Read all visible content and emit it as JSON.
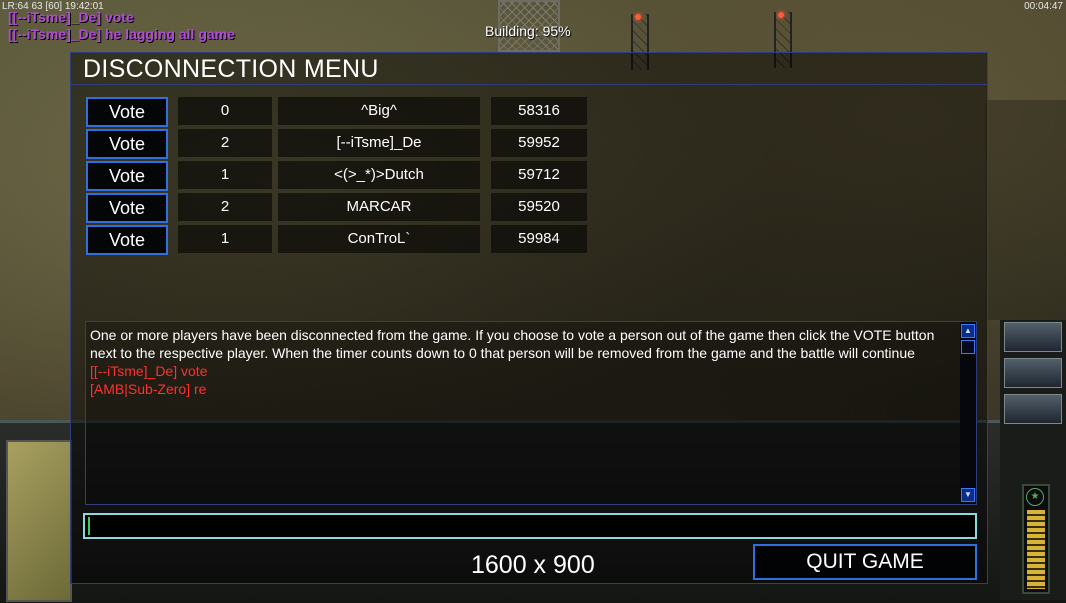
{
  "hud": {
    "top_left_stats": "LR:64 63 [60] 19:42:01",
    "top_right_timer": "00:04:47",
    "building_status": "Building: 95%"
  },
  "chat_overlay": [
    "[[--iTsme]_De] vote",
    "[[--iTsme]_De] he lagging all game"
  ],
  "dialog": {
    "title": "DISCONNECTION MENU",
    "vote_label": "Vote",
    "players": [
      {
        "votes": "0",
        "name": "^Big^",
        "ping": "58316"
      },
      {
        "votes": "2",
        "name": "[--iTsme]_De",
        "ping": "59952"
      },
      {
        "votes": "1",
        "name": "<(>_*)>Dutch",
        "ping": "59712"
      },
      {
        "votes": "2",
        "name": "MARCAR",
        "ping": "59520"
      },
      {
        "votes": "1",
        "name": "ConTroL`",
        "ping": "59984"
      }
    ],
    "messages": {
      "info": "One or more players have been disconnected from the game. If you choose to vote a person out of the game then click the VOTE button next to the respective player. When the timer counts down to 0 that person will be removed from the game and the battle will continue",
      "chat": [
        "[[--iTsme]_De] vote",
        "[AMB|Sub-Zero] re"
      ]
    },
    "chat_input_value": "",
    "resolution_label": "1600 x 900",
    "quit_label": "QUIT GAME"
  },
  "colors": {
    "accent_blue": "#2f6fe0",
    "chat_purple": "#b14bd9",
    "chat_red": "#ff3030"
  }
}
